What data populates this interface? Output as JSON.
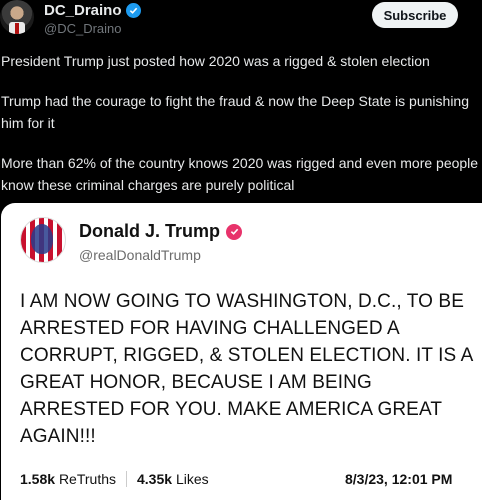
{
  "header": {
    "display_name": "DC_Draino",
    "handle": "@DC_Draino",
    "subscribe_label": "Subscribe"
  },
  "tweet": {
    "paragraphs": [
      "President Trump just posted how 2020 was a rigged & stolen election",
      "Trump had the courage to fight the fraud & now the Deep State is punishing him for it",
      "More than 62% of the country knows 2020 was rigged and even more people know these criminal charges are purely political"
    ]
  },
  "embedded_post": {
    "display_name": "Donald J. Trump",
    "handle": "@realDonaldTrump",
    "text": "I AM NOW GOING TO WASHINGTON, D.C., TO BE ARRESTED FOR HAVING CHALLENGED A CORRUPT, RIGGED, & STOLEN ELECTION. IT IS A GREAT HONOR, BECAUSE I AM BEING ARRESTED FOR YOU. MAKE AMERICA GREAT AGAIN!!!",
    "retruths_count": "1.58k",
    "retruths_label": "ReTruths",
    "likes_count": "4.35k",
    "likes_label": "Likes",
    "date": "8/3/23, 12:01 PM"
  },
  "colors": {
    "verified_blue": "#1d9bf0",
    "truth_badge_pink": "#e8336b",
    "background": "#000000"
  }
}
